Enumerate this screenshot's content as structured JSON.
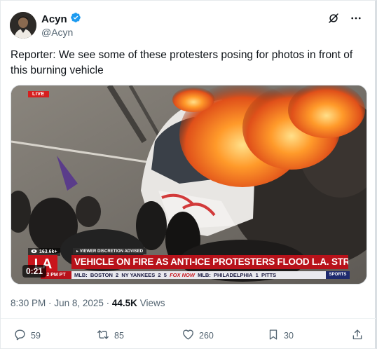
{
  "author": {
    "name": "Acyn",
    "handle": "@Acyn",
    "verified": true,
    "verified_color": "#1d9bf0"
  },
  "tweet": {
    "text": "Reporter: We see some of these protesters posing for photos in front of this burning vehicle"
  },
  "media": {
    "live_label": "LIVE",
    "viewer_count": "163.6k+",
    "advisory": "VIEWER DISCRETION ADVISED",
    "logo_text": "LA",
    "headline": "VEHICLE ON FIRE AS ANTI-ICE PROTESTERS FLOOD L.A. STREETS",
    "time": "2 PM PT",
    "ticker": {
      "league": "MLB:",
      "team1": "BOSTON",
      "score1": "2",
      "team2": "NY YANKEES",
      "score2": "2",
      "score3": "5",
      "brand": "FOX NOW",
      "league2": "MLB:",
      "team3": "PHILADELPHIA",
      "score4": "1",
      "team4": "PITTS"
    },
    "sports_label": "SPORTS",
    "duration": "0:21"
  },
  "meta": {
    "time": "8:30 PM",
    "sep": "·",
    "date": "Jun 8, 2025",
    "sep2": "·",
    "views_count": "44.5K",
    "views_label": "Views"
  },
  "actions": {
    "replies": "59",
    "reposts": "85",
    "likes": "260",
    "bookmarks": "30"
  },
  "colors": {
    "text": "#0f1419",
    "secondary": "#536471",
    "accent": "#1d9bf0",
    "news_red": "#b8121a"
  }
}
